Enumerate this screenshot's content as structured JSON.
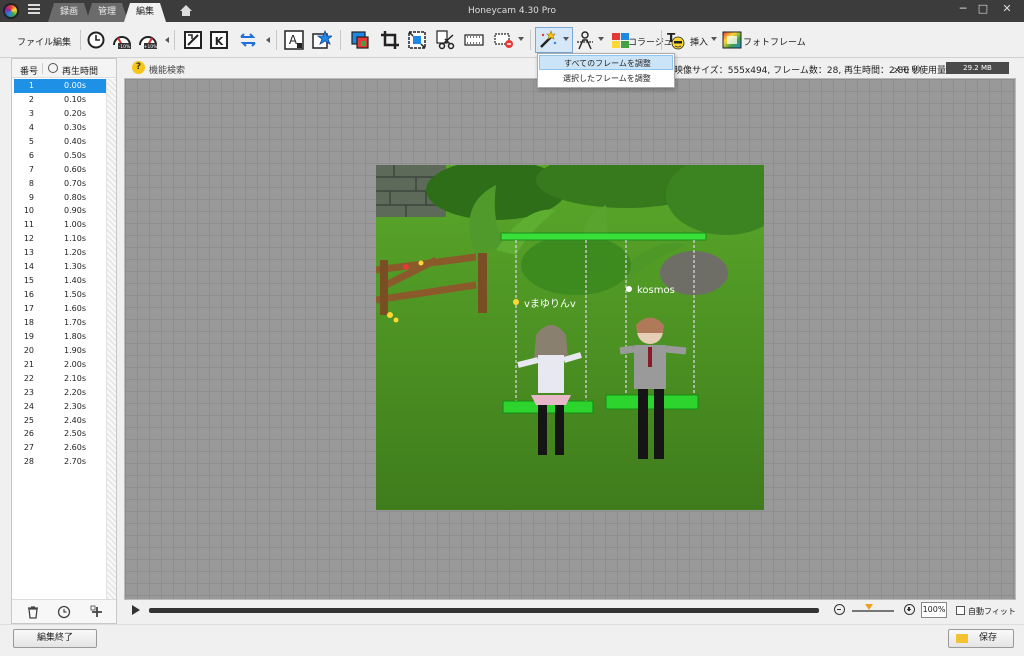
{
  "titlebar": {
    "title": "Honeycam 4.30 Pro",
    "tabs": [
      {
        "label": "録画"
      },
      {
        "label": "管理"
      },
      {
        "label": "編集"
      }
    ],
    "minimize": "─",
    "maximize": "□",
    "close": "✕"
  },
  "toolbar": {
    "file": "ファイル",
    "edit": "編集",
    "collage": "コラージュ",
    "insert": "挿入",
    "photoframe": "フォトフレーム"
  },
  "dropdown": {
    "items": [
      {
        "label": "すべてのフレームを調整"
      },
      {
        "label": "選択したフレームを調整"
      }
    ]
  },
  "frames": {
    "header_num": "番号",
    "header_time": "再生時間",
    "selected_index": 0,
    "rows": [
      {
        "num": "1",
        "time": "0.00s"
      },
      {
        "num": "2",
        "time": "0.10s"
      },
      {
        "num": "3",
        "time": "0.20s"
      },
      {
        "num": "4",
        "time": "0.30s"
      },
      {
        "num": "5",
        "time": "0.40s"
      },
      {
        "num": "6",
        "time": "0.50s"
      },
      {
        "num": "7",
        "time": "0.60s"
      },
      {
        "num": "8",
        "time": "0.70s"
      },
      {
        "num": "9",
        "time": "0.80s"
      },
      {
        "num": "10",
        "time": "0.90s"
      },
      {
        "num": "11",
        "time": "1.00s"
      },
      {
        "num": "12",
        "time": "1.10s"
      },
      {
        "num": "13",
        "time": "1.20s"
      },
      {
        "num": "14",
        "time": "1.30s"
      },
      {
        "num": "15",
        "time": "1.40s"
      },
      {
        "num": "16",
        "time": "1.50s"
      },
      {
        "num": "17",
        "time": "1.60s"
      },
      {
        "num": "18",
        "time": "1.70s"
      },
      {
        "num": "19",
        "time": "1.80s"
      },
      {
        "num": "20",
        "time": "1.90s"
      },
      {
        "num": "21",
        "time": "2.00s"
      },
      {
        "num": "22",
        "time": "2.10s"
      },
      {
        "num": "23",
        "time": "2.20s"
      },
      {
        "num": "24",
        "time": "2.30s"
      },
      {
        "num": "25",
        "time": "2.40s"
      },
      {
        "num": "26",
        "time": "2.50s"
      },
      {
        "num": "27",
        "time": "2.60s"
      },
      {
        "num": "28",
        "time": "2.70s"
      }
    ]
  },
  "infobar": {
    "hint": "機能検索",
    "info": "映像サイズ：555x494, フレーム数：28, 再生時間：2.80 秒",
    "memory_label": "メモリ使用量：",
    "memory_value": "29.2 MB"
  },
  "scene": {
    "name_left": "vまゆりんv",
    "name_right": "kosmos"
  },
  "playbar": {
    "zoom": "100%",
    "autofit": "自動フィット",
    "autofit_checked": false
  },
  "bottom": {
    "finish": "編集終了",
    "save": "保存"
  },
  "icons": {
    "toolbar": [
      "time-icon",
      "speed-down-icon",
      "speed-up-icon",
      "frame-reduce-icon",
      "keyframe-icon",
      "reverse-icon",
      "text-icon",
      "sticker-icon",
      "image-overlay-icon",
      "crop-icon",
      "resize-icon",
      "cut-icon",
      "film-icon",
      "delete-frames-icon",
      "magic-wand-icon",
      "effect-icon",
      "collage-icon",
      "insert-icon",
      "photoframe-icon"
    ]
  }
}
